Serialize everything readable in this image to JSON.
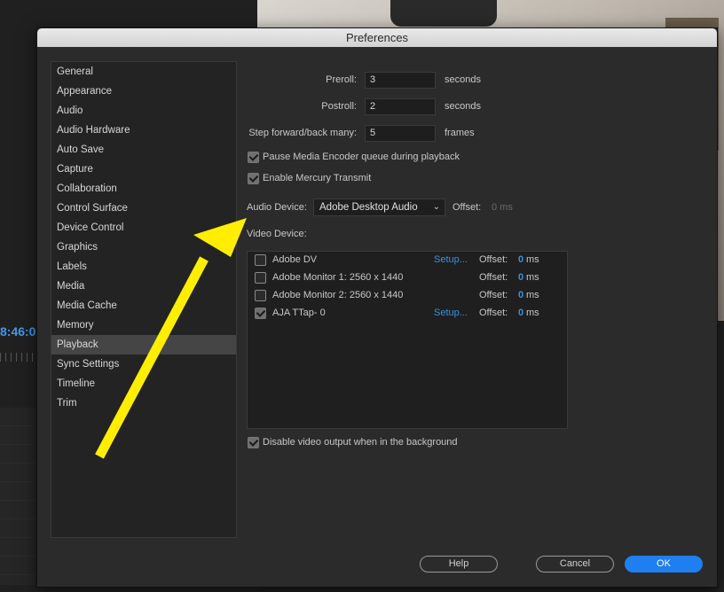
{
  "dialog": {
    "title": "Preferences"
  },
  "background": {
    "timecode": "8:46:0"
  },
  "sidebar": {
    "selected_index": 14,
    "items": [
      {
        "label": "General"
      },
      {
        "label": "Appearance"
      },
      {
        "label": "Audio"
      },
      {
        "label": "Audio Hardware"
      },
      {
        "label": "Auto Save"
      },
      {
        "label": "Capture"
      },
      {
        "label": "Collaboration"
      },
      {
        "label": "Control Surface"
      },
      {
        "label": "Device Control"
      },
      {
        "label": "Graphics"
      },
      {
        "label": "Labels"
      },
      {
        "label": "Media"
      },
      {
        "label": "Media Cache"
      },
      {
        "label": "Memory"
      },
      {
        "label": "Playback"
      },
      {
        "label": "Sync Settings"
      },
      {
        "label": "Timeline"
      },
      {
        "label": "Trim"
      }
    ]
  },
  "playback": {
    "preroll": {
      "label": "Preroll:",
      "value": "3",
      "unit": "seconds"
    },
    "postroll": {
      "label": "Postroll:",
      "value": "2",
      "unit": "seconds"
    },
    "step": {
      "label": "Step forward/back many:",
      "value": "5",
      "unit": "frames"
    },
    "pause_encoder": {
      "label": "Pause Media Encoder queue during playback",
      "checked": true
    },
    "mercury": {
      "label": "Enable Mercury Transmit",
      "checked": true
    },
    "audio_device": {
      "label": "Audio Device:",
      "value": "Adobe Desktop Audio",
      "offset_label": "Offset:",
      "offset_value": "0 ms"
    },
    "video_device": {
      "label": "Video Device:"
    },
    "devices": [
      {
        "name": "Adobe DV",
        "checked": false,
        "setup": "Setup...",
        "offset_label": "Offset:",
        "offset_value": "0",
        "offset_unit": "ms"
      },
      {
        "name": "Adobe Monitor 1: 2560 x 1440",
        "checked": false,
        "setup": "",
        "offset_label": "Offset:",
        "offset_value": "0",
        "offset_unit": "ms"
      },
      {
        "name": "Adobe Monitor 2: 2560 x 1440",
        "checked": false,
        "setup": "",
        "offset_label": "Offset:",
        "offset_value": "0",
        "offset_unit": "ms"
      },
      {
        "name": "AJA TTap- 0",
        "checked": true,
        "setup": "Setup...",
        "offset_label": "Offset:",
        "offset_value": "0",
        "offset_unit": "ms"
      }
    ],
    "disable_bg": {
      "label": "Disable video output when in the background",
      "checked": true
    }
  },
  "buttons": {
    "help": "Help",
    "cancel": "Cancel",
    "ok": "OK"
  },
  "colors": {
    "accent": "#1f7ff0",
    "link": "#3a90e0",
    "annotation_arrow": "#ffee00"
  }
}
